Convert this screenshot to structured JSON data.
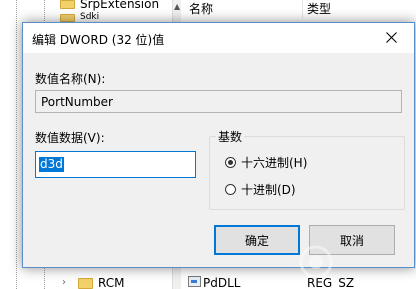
{
  "background": {
    "tree": {
      "top_item": "SrpExtension",
      "partial_item": "Sdki",
      "bottom_item": "RCM"
    },
    "list": {
      "col_name": "名称",
      "col_type": "类型",
      "row_name": "PdDLL",
      "row_type": "REG_SZ"
    }
  },
  "dialog": {
    "title": "编辑 DWORD (32 位)值",
    "name_label": "数值名称(N):",
    "name_value": "PortNumber",
    "data_label": "数值数据(V):",
    "data_value": "d3d",
    "base_group": {
      "label": "基数",
      "options": [
        {
          "label": "十六进制(H)",
          "checked": true
        },
        {
          "label": "十进制(D)",
          "checked": false
        }
      ]
    },
    "ok_label": "确定",
    "cancel_label": "取消"
  },
  "colors": {
    "accent": "#0078d7",
    "dialog_bg": "#f0f0f0",
    "folder": "#f2d16b"
  }
}
